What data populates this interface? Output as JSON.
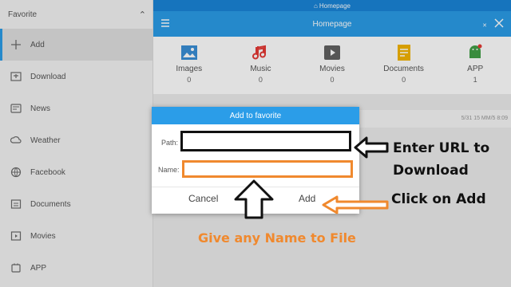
{
  "sidebar": {
    "header": "Favorite",
    "items": [
      {
        "label": "Add",
        "icon": "plus-icon"
      },
      {
        "label": "Download",
        "icon": "download-icon"
      },
      {
        "label": "News",
        "icon": "news-icon"
      },
      {
        "label": "Weather",
        "icon": "weather-icon"
      },
      {
        "label": "Facebook",
        "icon": "globe-icon"
      },
      {
        "label": "Documents",
        "icon": "document-icon"
      },
      {
        "label": "Movies",
        "icon": "movie-icon"
      },
      {
        "label": "APP",
        "icon": "app-icon"
      }
    ]
  },
  "status_bar": {
    "title": "Homepage"
  },
  "toolbar": {
    "title": "Homepage"
  },
  "categories": [
    {
      "label": "Images",
      "count": "0",
      "color": "#3a8fd6"
    },
    {
      "label": "Music",
      "count": "0",
      "color": "#e53935"
    },
    {
      "label": "Movies",
      "count": "0",
      "color": "#616161"
    },
    {
      "label": "Documents",
      "count": "0",
      "color": "#f4b400"
    },
    {
      "label": "APP",
      "count": "1",
      "color": "#43a047"
    }
  ],
  "info_time": "5/31 15 MM/5 8:09",
  "dialog": {
    "title": "Add to favorite",
    "path_label": "Path:",
    "path_value": "",
    "name_label": "Name:",
    "name_value": "",
    "cancel_label": "Cancel",
    "add_label": "Add"
  },
  "annotations": {
    "enter_url_line1": "Enter URL to",
    "enter_url_line2": "Download",
    "click_add": "Click on Add",
    "give_name": "Give any Name to File"
  },
  "colors": {
    "accent": "#2b9de8",
    "annotation_orange": "#f0892e",
    "annotation_black": "#111111"
  }
}
